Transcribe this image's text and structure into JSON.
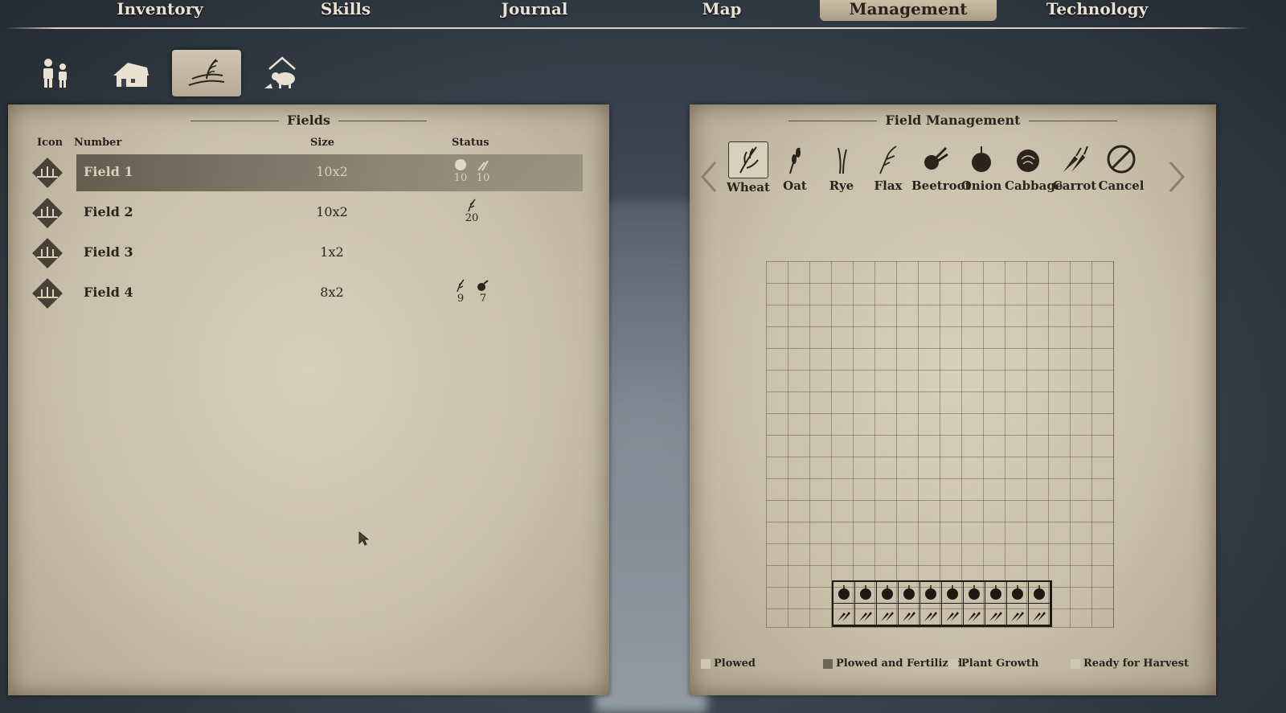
{
  "nav": {
    "tabs": [
      {
        "label": "Inventory"
      },
      {
        "label": "Skills"
      },
      {
        "label": "Journal"
      },
      {
        "label": "Map"
      },
      {
        "label": "Management"
      },
      {
        "label": "Technology"
      }
    ],
    "active_tab": "Management"
  },
  "subtabs": {
    "icons": [
      "villagers-icon",
      "buildings-icon",
      "fields-icon",
      "livestock-icon"
    ],
    "active": "fields-icon"
  },
  "fields_panel": {
    "title": "Fields",
    "columns": {
      "icon": "Icon",
      "number": "Number",
      "size": "Size",
      "status": "Status"
    },
    "rows": [
      {
        "name": "Field 1",
        "size": "10x2",
        "status": [
          {
            "icon": "plowed-icon",
            "count": "10"
          },
          {
            "icon": "carrot-icon",
            "count": "10"
          }
        ],
        "selected": true
      },
      {
        "name": "Field 2",
        "size": "10x2",
        "status": [
          {
            "icon": "flax-icon",
            "count": "20"
          }
        ],
        "selected": false
      },
      {
        "name": "Field 3",
        "size": "1x2",
        "status": [],
        "selected": false
      },
      {
        "name": "Field 4",
        "size": "8x2",
        "status": [
          {
            "icon": "flax-icon",
            "count": "9"
          },
          {
            "icon": "beetroot-icon",
            "count": "7"
          }
        ],
        "selected": false
      }
    ]
  },
  "field_management": {
    "title": "Field Management",
    "crops": [
      {
        "label": "Wheat",
        "icon": "wheat-icon",
        "selected": true
      },
      {
        "label": "Oat",
        "icon": "oat-icon",
        "selected": false
      },
      {
        "label": "Rye",
        "icon": "rye-icon",
        "selected": false
      },
      {
        "label": "Flax",
        "icon": "flax-icon",
        "selected": false
      },
      {
        "label": "Beetroot",
        "icon": "beetroot-icon",
        "selected": false
      },
      {
        "label": "Onion",
        "icon": "onion-icon",
        "selected": false
      },
      {
        "label": "Cabbage",
        "icon": "cabbage-icon",
        "selected": false
      },
      {
        "label": "Carrot",
        "icon": "carrot-icon",
        "selected": false
      },
      {
        "label": "Cancel",
        "icon": "cancel-icon",
        "selected": false
      }
    ],
    "plot_grid": {
      "columns": 10,
      "rows": [
        {
          "crop": "onion-icon"
        },
        {
          "crop": "carrot-icon"
        }
      ]
    },
    "legend": [
      {
        "label": "Plowed",
        "color": "#cfc6b3"
      },
      {
        "label": "Plowed and Fertilized",
        "color": "#6e6558"
      },
      {
        "label": "Plant Growth",
        "color": "#cfc6b3"
      },
      {
        "label": "Ready for Harvest",
        "color": "#cfc6b3"
      }
    ]
  },
  "colors": {
    "parchment": "#c9bfac",
    "ink": "#2b241b",
    "nav_text": "#e9e2d2"
  }
}
